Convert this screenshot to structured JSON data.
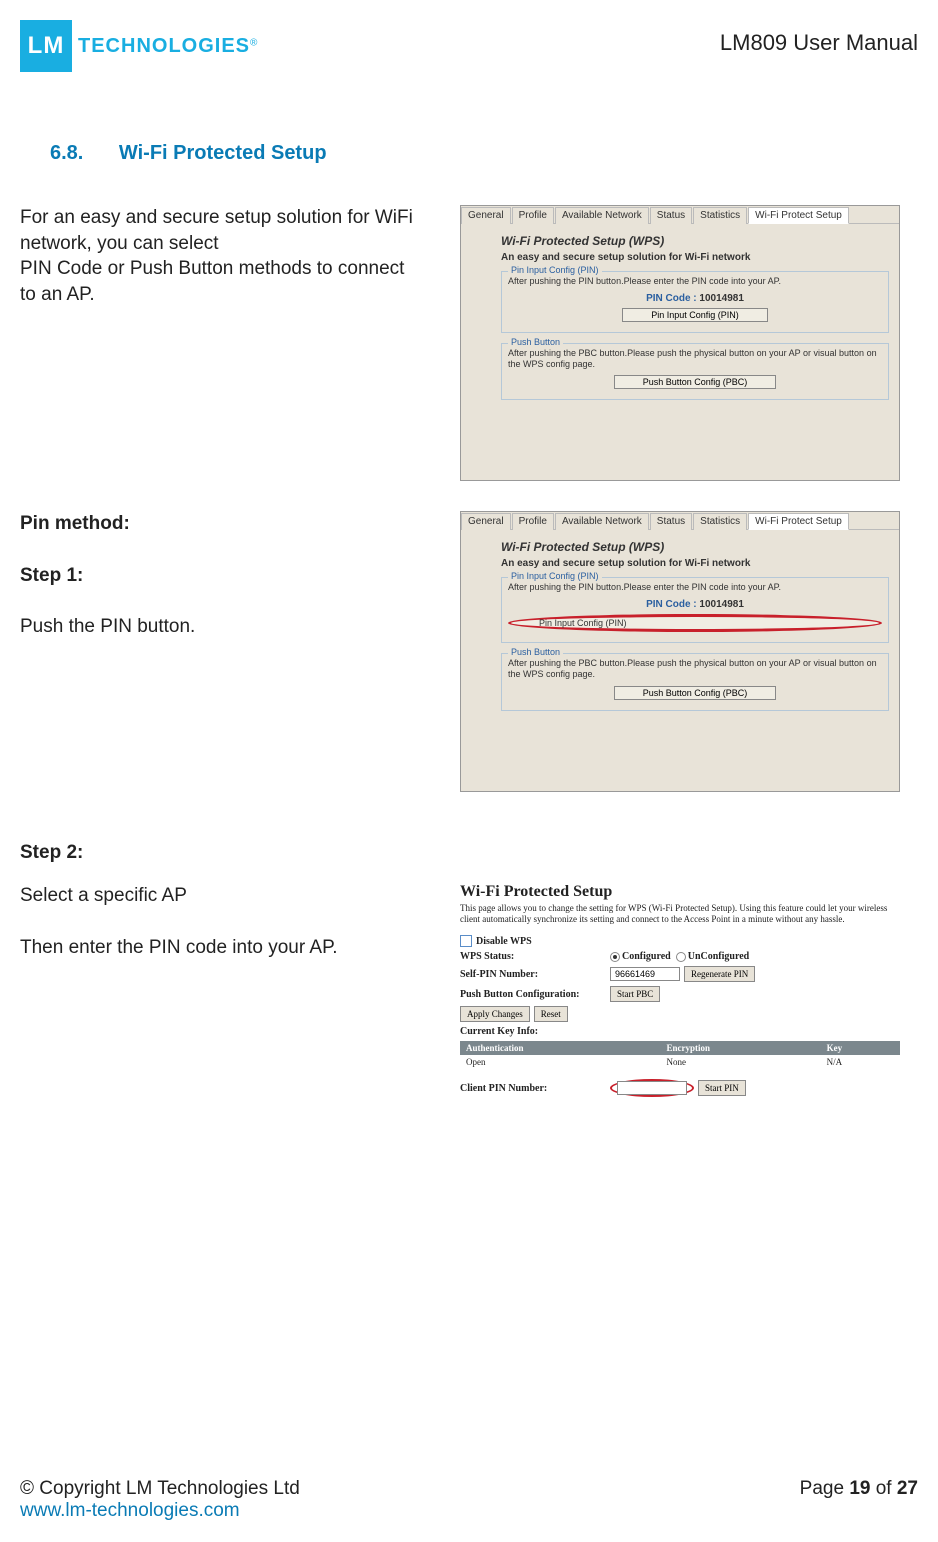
{
  "header": {
    "logo_mark": "LM",
    "logo_text": "TECHNOLOGIES",
    "reg_mark": "®",
    "doc_title": "LM809 User Manual"
  },
  "section": {
    "number": "6.8.",
    "title": "Wi-Fi Protected Setup"
  },
  "intro": {
    "line1": "For an easy and secure setup solution for WiFi network, you can select",
    "line2": "PIN Code or Push Button methods to connect to an AP."
  },
  "pin_method_label": "Pin method:",
  "step1_label": "Step 1:",
  "step1_text": "Push the PIN button.",
  "step2_label": "Step 2:",
  "step2_text1": "Select a specific AP",
  "step2_text2": "Then enter the PIN code into your AP.",
  "dialog": {
    "tabs": [
      "General",
      "Profile",
      "Available Network",
      "Status",
      "Statistics",
      "Wi-Fi Protect Setup"
    ],
    "active_tab_index": 5,
    "title": "Wi-Fi Protected Setup (WPS)",
    "subtitle": "An easy and secure setup solution for Wi-Fi network",
    "pin_group": {
      "label": "Pin Input Config (PIN)",
      "text": "After pushing the PIN button.Please enter the PIN code into your AP.",
      "pin_label": "PIN Code :",
      "pin_value": "10014981",
      "button": "Pin Input Config (PIN)"
    },
    "push_group": {
      "label": "Push Button",
      "text": "After pushing the PBC button.Please push the physical button on your AP or visual button on the WPS config page.",
      "button": "Push Button Config (PBC)"
    }
  },
  "ap": {
    "title": "Wi-Fi Protected Setup",
    "desc": "This page allows you to change the setting for WPS (Wi-Fi Protected Setup). Using this feature could let your wireless client automatically synchronize its setting and connect to the Access Point in a minute without any hassle.",
    "disable_label": "Disable WPS",
    "status_label": "WPS Status:",
    "status_opt1": "Configured",
    "status_opt2": "UnConfigured",
    "selfpin_label": "Self-PIN Number:",
    "selfpin_value": "96661469",
    "regen_btn": "Regenerate PIN",
    "pbc_label": "Push Button Configuration:",
    "startpbc_btn": "Start PBC",
    "apply_btn": "Apply Changes",
    "reset_btn": "Reset",
    "keyinfo_label": "Current Key Info:",
    "table": {
      "headers": [
        "Authentication",
        "Encryption",
        "Key"
      ],
      "row": [
        "Open",
        "None",
        "N/A"
      ]
    },
    "clientpin_label": "Client PIN Number:",
    "clientpin_value": "",
    "startpin_btn": "Start PIN"
  },
  "footer": {
    "copyright": "© Copyright LM Technologies Ltd",
    "url": "www.lm-technologies.com",
    "page_prefix": "Page ",
    "page_current": "19",
    "page_sep": " of ",
    "page_total": "27"
  }
}
